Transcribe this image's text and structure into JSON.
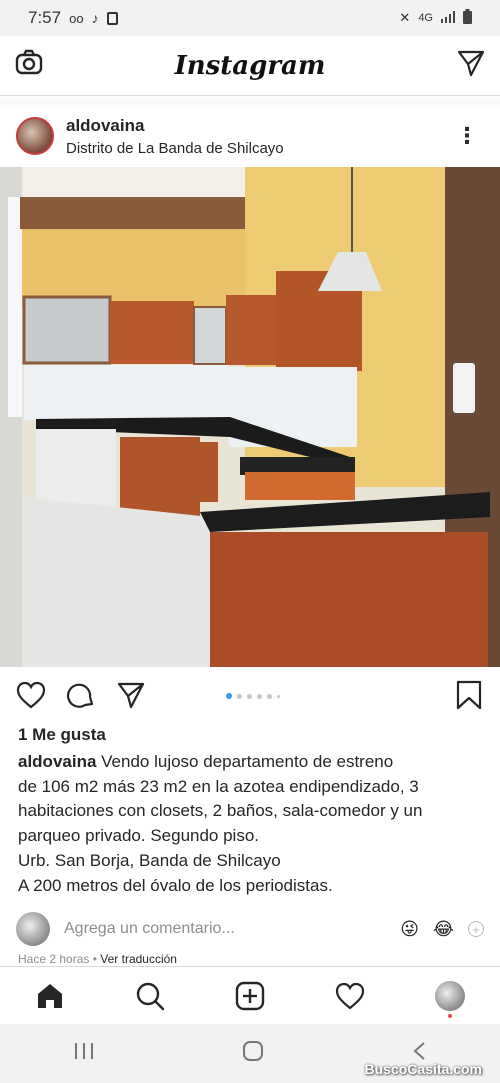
{
  "status_bar": {
    "time": "7:57",
    "network": "4G"
  },
  "app": {
    "title": "Instagram"
  },
  "post": {
    "username": "aldovaina",
    "location": "Distrito de La Banda de Shilcayo",
    "more_label": "⋮",
    "likes": "1 Me gusta",
    "caption_user": "aldovaina",
    "caption_lines": [
      "Vendo lujoso departamento de estreno",
      "de 106 m2 más 23 m2 en la azotea endipendizado, 3",
      "habitaciones con closets, 2 baños, sala-comedor y un",
      "parqueo privado. Segundo piso.",
      "Urb. San Borja, Banda de Shilcayo",
      "A 200 metros del óvalo de los periodistas."
    ],
    "comment_placeholder": "Agrega un comentario...",
    "emojis": [
      "😜",
      "😂"
    ],
    "plus_label": "+",
    "time_ago": "Hace 2 horas",
    "separator": "•",
    "translate_label": "Ver traducción"
  },
  "watermark": "BuscoCasita.com",
  "colors": {
    "accent": "#3897f0",
    "text": "#262626",
    "muted": "#8e8e8e",
    "notification": "#ed4956"
  },
  "icons": [
    "camera-icon",
    "direct-message-icon",
    "heart-icon",
    "comment-icon",
    "share-icon",
    "bookmark-icon",
    "home-icon",
    "search-icon",
    "new-post-icon",
    "activity-icon"
  ]
}
